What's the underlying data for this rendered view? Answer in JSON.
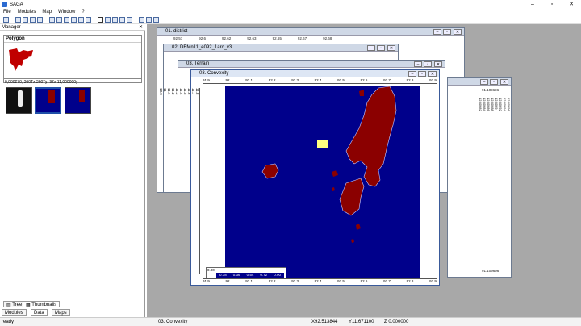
{
  "app": {
    "title": "SAGA"
  },
  "menu": [
    "File",
    "Modules",
    "Map",
    "Window",
    "?"
  ],
  "manager": {
    "title": "Manager",
    "layer_title": "Polygon",
    "info": "0,000270; 360Tx 360Ty; 92x 11,000000y",
    "tabs": {
      "tree": "Tree",
      "thumbnails": "Thumbnails"
    },
    "bottom_tabs": [
      "Modules",
      "Data",
      "Maps"
    ]
  },
  "windows": {
    "w1": {
      "title": "01. district"
    },
    "w2": {
      "title": "02. DEMn11_e092_1arc_v3"
    },
    "w3": {
      "title": "03. Terrain"
    },
    "w4": {
      "title": "03. Convexity"
    }
  },
  "top_ruler": [
    "91.9",
    "92",
    "92.1",
    "92.2",
    "92.3",
    "92.4",
    "92.5",
    "92.6",
    "92.7",
    "92.8",
    "92.9"
  ],
  "left_ruler": [
    "11.8",
    "11.7",
    "11.6",
    "11.5",
    "11.4",
    "11.3",
    "11.2",
    "11.1",
    "11",
    "10.9"
  ],
  "back_ruler": [
    "92.57",
    "92.6",
    "92.62",
    "92.63",
    "92.65",
    "92.67",
    "92.68"
  ],
  "right_ruler": [
    "12.40696",
    "12.40694",
    "12.40692",
    "12.4069",
    "12.40688",
    "12.40686",
    "12.40684",
    "12.40682"
  ],
  "right_ruler_top": "91.109696",
  "right_ruler_bottom": "91.109696",
  "legend": {
    "min": "0.00",
    "ticks": [
      "0.18",
      "0.36",
      "0.54",
      "0.72",
      "0.90"
    ]
  },
  "status": {
    "left": "ready",
    "layer": "03. Convexity",
    "x": "X92.513844",
    "y": "Y11.671100",
    "z": "Z 0.000000"
  },
  "colors": {
    "water": "#00008b",
    "land": "#8b0000",
    "marker": "#ffff80"
  }
}
